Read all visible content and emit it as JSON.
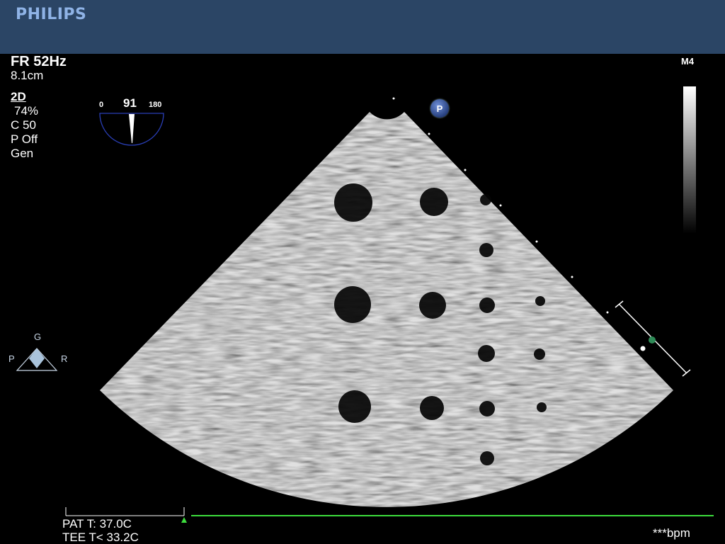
{
  "header": {
    "brand": "PHILIPS"
  },
  "params": {
    "frame_rate": "FR 52Hz",
    "depth": "8.1cm",
    "mode": "2D",
    "gain": "74%",
    "compress": "C 50",
    "persistence": "P Off",
    "frequency": "Gen"
  },
  "multiplane": {
    "min": "0",
    "angle": "91",
    "max": "180"
  },
  "probe_badge": "P",
  "transducer": "M4",
  "orientation": {
    "top": "G",
    "left": "P",
    "right": "R"
  },
  "footer": {
    "pat_temp": "PAT T: 37.0C",
    "tee_temp": "TEE T< 33.2C",
    "heart_rate": "***bpm"
  },
  "colors": {
    "header_bg": "#2b4565",
    "brand": "#8fb3e6",
    "ecg_line": "#3ddc3d",
    "angle_indicator": "#2a3fb8"
  }
}
